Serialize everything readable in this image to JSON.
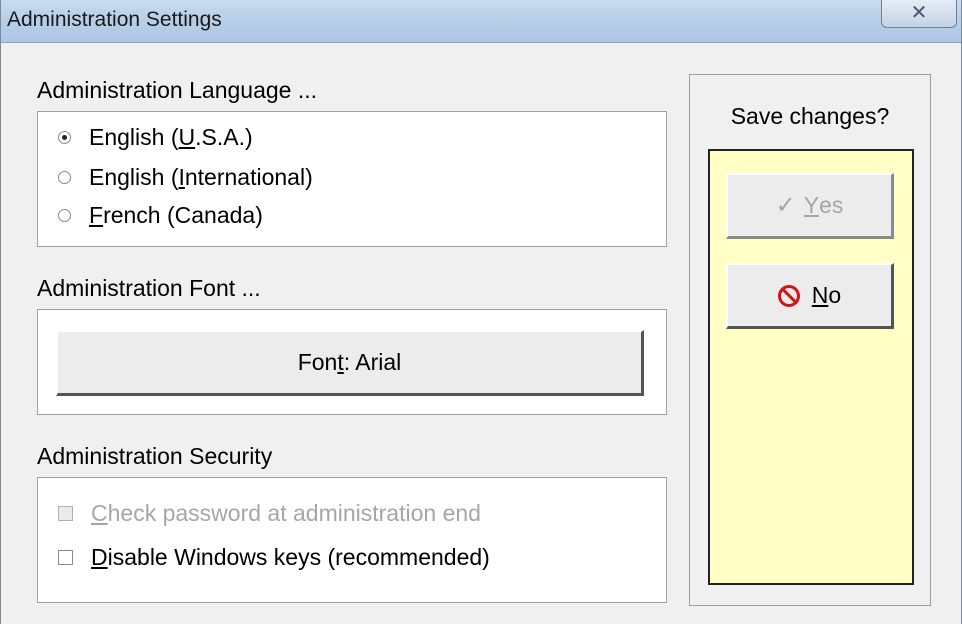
{
  "window": {
    "title": "Administration Settings",
    "close_glyph": "✕"
  },
  "language": {
    "heading": "Administration Language ...",
    "options": [
      {
        "pre": "English (",
        "accel": "U",
        "post": ".S.A.)",
        "selected": true
      },
      {
        "pre": "English (",
        "accel": "I",
        "post": "nternational)",
        "selected": false
      },
      {
        "pre": "",
        "accel": "F",
        "post": "rench (Canada)",
        "selected": false
      }
    ]
  },
  "font": {
    "heading": "Administration Font ...",
    "button_pre": "Fon",
    "button_accel": "t",
    "button_post": ": Arial"
  },
  "security": {
    "heading": "Administration Security",
    "checks": [
      {
        "accel": "C",
        "post": "heck password at administration end",
        "checked": false,
        "enabled": false
      },
      {
        "accel": "D",
        "post": "isable Windows keys (recommended)",
        "checked": false,
        "enabled": true
      }
    ]
  },
  "save": {
    "question": "Save changes?",
    "yes_accel": "Y",
    "yes_post": "es",
    "yes_enabled": false,
    "no_accel": "N",
    "no_post": "o",
    "icons": {
      "yes": "checkmark-icon",
      "no": "prohibited-icon"
    },
    "colors": {
      "panel": "#ffffc6",
      "no_icon": "#d0141a"
    }
  }
}
